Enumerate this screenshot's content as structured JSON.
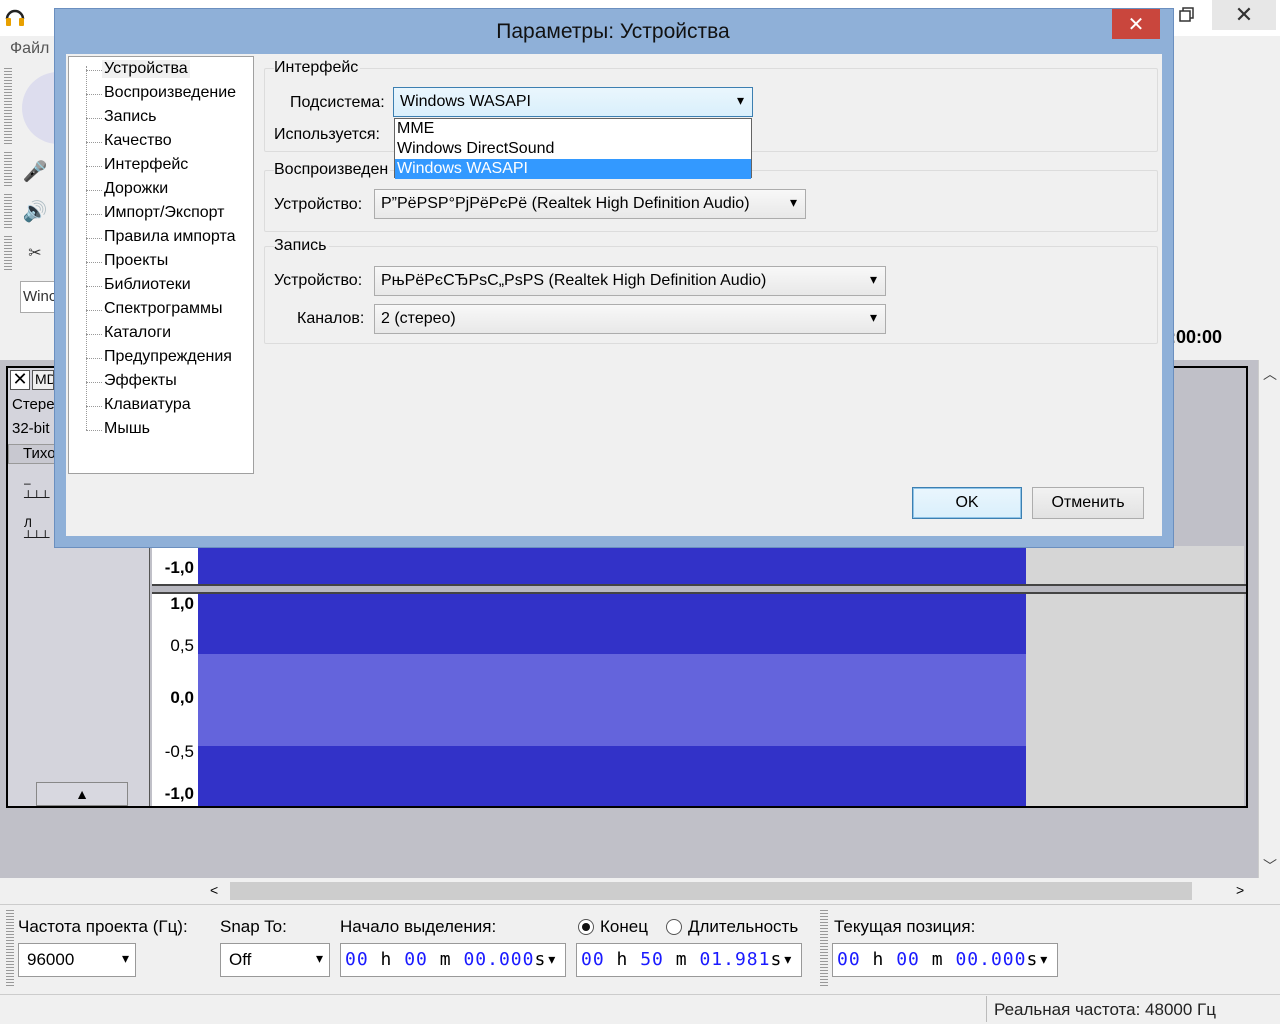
{
  "main": {
    "menu_file": "Файл",
    "host_combo": "Winc",
    "ruler_time": ":00:00",
    "track": {
      "name": "MD",
      "info1": "Стере",
      "info2": "32-bit",
      "mute": "Тихо"
    },
    "vruler_top": [
      "-1,0"
    ],
    "vruler_bottom": [
      "1,0",
      "0,5",
      "0,0",
      "-0,5",
      "-1,0"
    ]
  },
  "selection_toolbar": {
    "rate_label": "Частота проекта (Гц):",
    "rate_value": "96000",
    "snap_label": "Snap To:",
    "snap_value": "Off",
    "sel_start_label": "Начало выделения:",
    "sel_start": {
      "h": "00",
      "m": "00",
      "s": "00.000"
    },
    "end_label": "Конец",
    "length_label": "Длительность",
    "sel_end": {
      "h": "00",
      "m": "50",
      "s": "01.981"
    },
    "position_label": "Текущая позиция:",
    "position": {
      "h": "00",
      "m": "00",
      "s": "00.000"
    },
    "units": {
      "h": "h",
      "m": "m",
      "s": "s"
    }
  },
  "status": {
    "actual_rate": "Реальная частота: 48000 Гц"
  },
  "dialog": {
    "title": "Параметры: Устройства",
    "tree": [
      "Устройства",
      "Воспроизведение",
      "Запись",
      "Качество",
      "Интерфейс",
      "Дорожки",
      "Импорт/Экспорт",
      "Правила импорта",
      "Проекты",
      "Библиотеки",
      "Спектрограммы",
      "Каталоги",
      "Предупреждения",
      "Эффекты",
      "Клавиатура",
      "Мышь"
    ],
    "interface_group": "Интерфейс",
    "host_label": "Подсистема:",
    "host_value": "Windows WASAPI",
    "using_label": "Используется:",
    "host_options": [
      "MME",
      "Windows DirectSound",
      "Windows WASAPI"
    ],
    "playback_group": "Воспроизведен",
    "playback_device_label": "Устройство:",
    "playback_device_value": "Р”РёРЅР°РјРёРєРё (Realtek High Definition Audio)",
    "recording_group": "Запись",
    "recording_device_label": "Устройство:",
    "recording_device_value": "РњРёРєСЂРѕС„РѕРЅ (Realtek High Definition Audio)",
    "channels_label": "Каналов:",
    "channels_value": "2 (стерео)",
    "ok": "OK",
    "cancel": "Отменить"
  }
}
